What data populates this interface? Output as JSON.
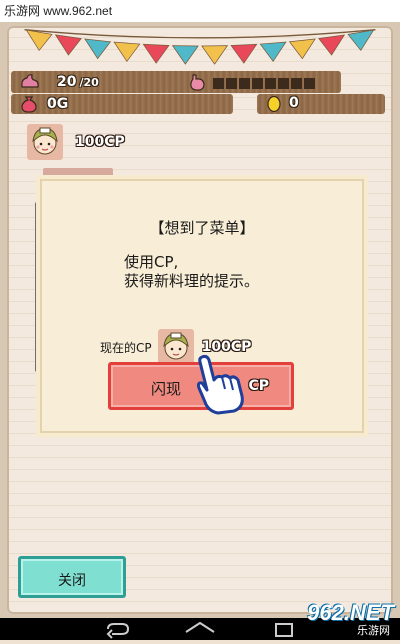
{
  "watermark": {
    "top": "乐游网 www.962.net",
    "bottom_logo": "962.NET",
    "bottom_sub": "乐游网"
  },
  "stats": {
    "stamina_value": "20",
    "stamina_max": "/20",
    "money": "0G",
    "eggs": "0",
    "cp": "100CP",
    "hunger_cells_filled": 0
  },
  "dialog": {
    "title": "【想到了菜单】",
    "body_line1": "使用CP,",
    "body_line2": "获得新料理的提示。",
    "current_label": "现在的CP",
    "current_value": "100CP",
    "flash_button_label": "闪现",
    "flash_button_cp": "CP"
  },
  "close_button_label": "关闭",
  "colors": {
    "bunting": [
      "#f2c14b",
      "#e8485a",
      "#4fb8c9",
      "#f2c14b",
      "#e8485a",
      "#4fb8c9",
      "#f2c14b",
      "#e8485a",
      "#4fb8c9",
      "#f2c14b",
      "#e8485a",
      "#4fb8c9"
    ],
    "flash_button": "#f08a80",
    "close_button": "#7fe0d2"
  }
}
